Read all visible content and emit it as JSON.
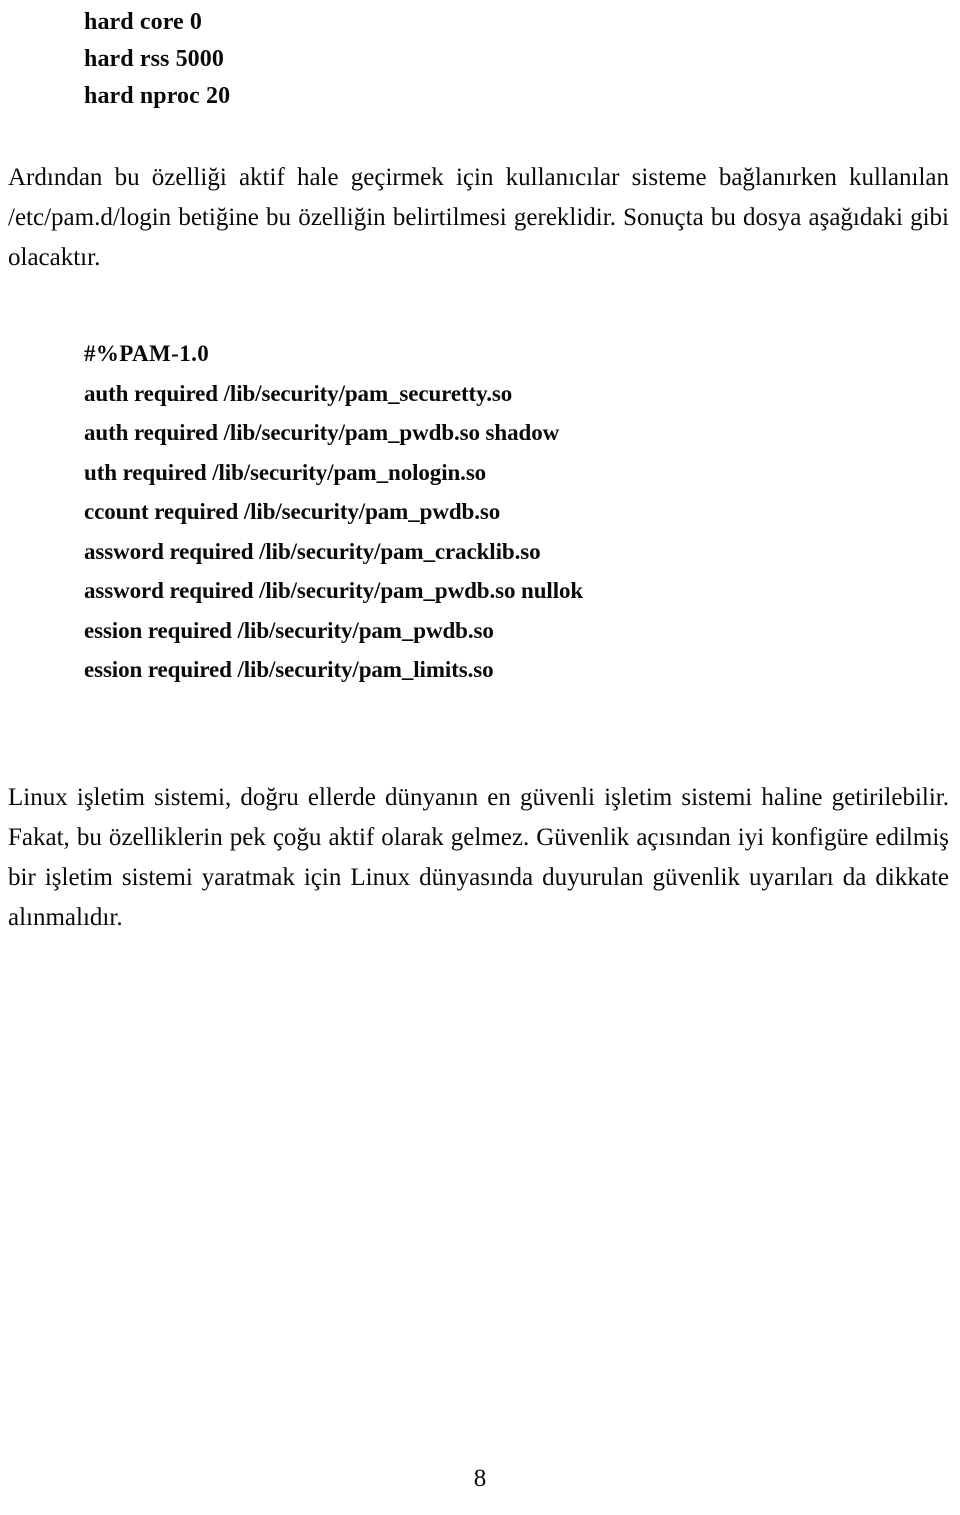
{
  "document": {
    "page_number": "8",
    "language": "tr"
  },
  "limits_block": {
    "lines": [
      "hard core 0",
      "hard rss 5000",
      "hard nproc 20"
    ]
  },
  "paragraphs": {
    "intro": "Ardından bu özelliği aktif hale geçirmek için kullanıcılar sisteme bağlanırken kullanılan /etc/pam.d/login betiğine bu özelliğin belirtilmesi gereklidir. Sonuçta bu dosya aşağıdaki gibi olacaktır.",
    "outro": "Linux işletim sistemi, doğru ellerde dünyanın en güvenli işletim sistemi haline getirilebilir. Fakat, bu özelliklerin pek çoğu aktif olarak gelmez. Güvenlik açısından iyi konfigüre edilmiş bir işletim sistemi yaratmak için Linux dünyasında duyurulan güvenlik uyarıları da dikkate alınmalıdır."
  },
  "pam_config": {
    "lines": [
      "#%PAM-1.0",
      "auth required /lib/security/pam_securetty.so",
      "auth required /lib/security/pam_pwdb.so shadow",
      "uth required /lib/security/pam_nologin.so",
      "ccount required /lib/security/pam_pwdb.so",
      "assword required /lib/security/pam_cracklib.so",
      "assword required /lib/security/pam_pwdb.so nullok",
      "ession required /lib/security/pam_pwdb.so",
      "ession required /lib/security/pam_limits.so"
    ]
  }
}
